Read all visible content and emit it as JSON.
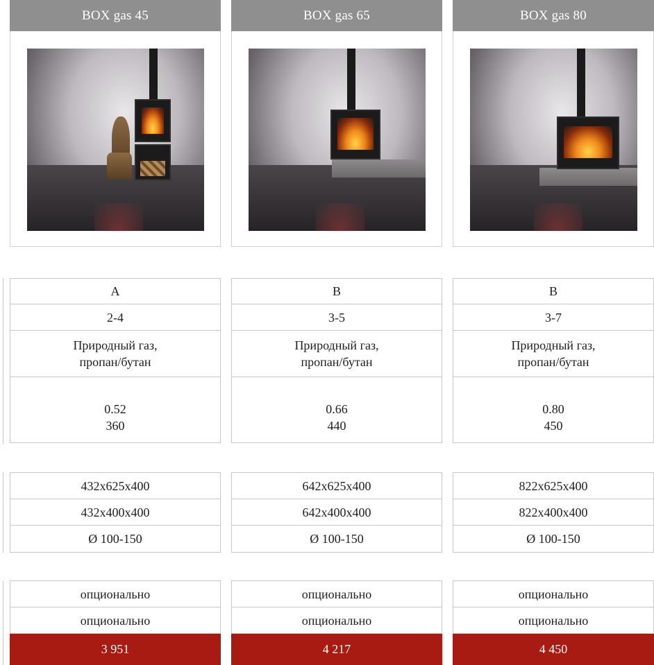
{
  "products": [
    {
      "name": "BOX gas 45",
      "rows_group1": [
        "A",
        "2-4"
      ],
      "fuel": [
        "Природный газ,",
        "пропан/бутан"
      ],
      "power": [
        "0.52",
        "360"
      ],
      "rows_group2": [
        "432x625x400",
        "432x400x400",
        "Ø 100-150"
      ],
      "rows_group3": [
        "опционально",
        "опционально"
      ],
      "price": "3 951"
    },
    {
      "name": "BOX gas 65",
      "rows_group1": [
        "B",
        "3-5"
      ],
      "fuel": [
        "Природный газ,",
        "пропан/бутан"
      ],
      "power": [
        "0.66",
        "440"
      ],
      "rows_group2": [
        "642x625x400",
        "642x400x400",
        "Ø 100-150"
      ],
      "rows_group3": [
        "опционально",
        "опционально"
      ],
      "price": "4 217"
    },
    {
      "name": "BOX gas 80",
      "rows_group1": [
        "B",
        "3-7"
      ],
      "fuel": [
        "Природный газ,",
        "пропан/бутан"
      ],
      "power": [
        "0.80",
        "450"
      ],
      "rows_group2": [
        "822x625x400",
        "822x400x400",
        "Ø 100-150"
      ],
      "rows_group3": [
        "опционально",
        "опционально"
      ],
      "price": "4 450"
    }
  ],
  "colors": {
    "header_bg": "#8f8f8f",
    "price_bg": "#a71b13",
    "border": "#c7c7c7"
  }
}
